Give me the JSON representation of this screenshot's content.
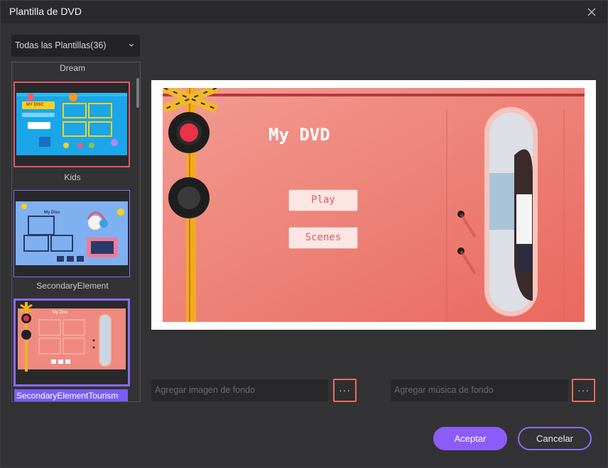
{
  "window": {
    "title": "Plantilla de DVD"
  },
  "filter": {
    "selected": "Todas las Plantillas(36)"
  },
  "templates": [
    {
      "label": "Dream"
    },
    {
      "label": "Kids"
    },
    {
      "label": "SecondaryElement"
    },
    {
      "label": "SecondaryElementTourism",
      "selected": true
    }
  ],
  "thumb_texts": {
    "kids_disc": "MY DISC",
    "sec_disc": "My Disc",
    "tour_disc": "My Disc"
  },
  "preview": {
    "title": "My DVD",
    "buttons": [
      "Play",
      "Scenes"
    ]
  },
  "inputs": {
    "background_image_placeholder": "Agregar imagen de fondo",
    "background_music_placeholder": "Agregar música de fondo",
    "browse_label": "···"
  },
  "actions": {
    "accept": "Aceptar",
    "cancel": "Cancelar"
  },
  "colors": {
    "accent": "#8c5cf6",
    "highlight_border": "#f06a5a",
    "preview_bg": "#ef8a80"
  }
}
